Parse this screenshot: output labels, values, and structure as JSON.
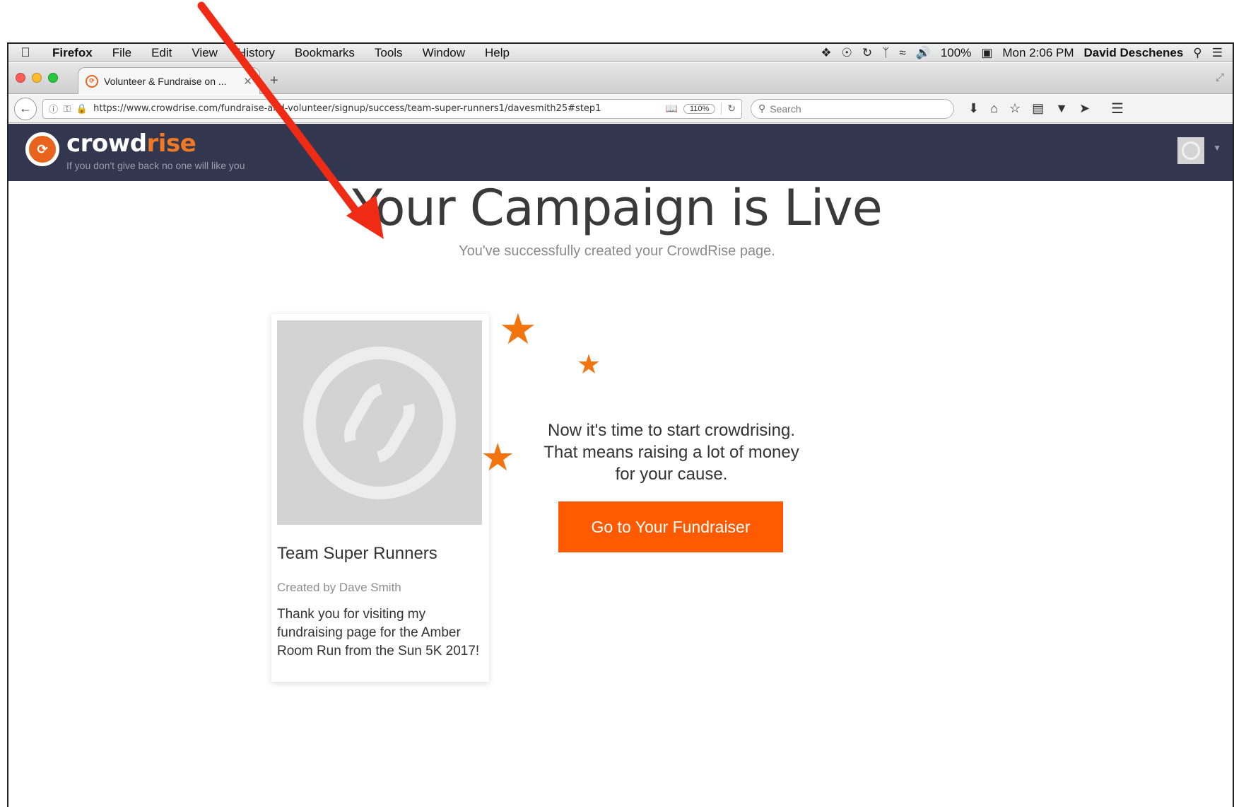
{
  "menubar": {
    "app": "Firefox",
    "items": [
      "File",
      "Edit",
      "View",
      "History",
      "Bookmarks",
      "Tools",
      "Window",
      "Help"
    ],
    "battery": "100%",
    "clock": "Mon 2:06 PM",
    "user": "David Deschenes"
  },
  "browser": {
    "tab_title": "Volunteer & Fundraise on ...",
    "url": "https://www.crowdrise.com/fundraise-and-volunteer/signup/success/team-super-runners1/davesmith25#step1",
    "zoom": "110%",
    "search_placeholder": "Search"
  },
  "site": {
    "brand_a": "crowd",
    "brand_b": "rise",
    "tagline": "If you don't give back no one will like you"
  },
  "hero": {
    "title": "Your Campaign is Live",
    "subtitle": "You've successfully created your CrowdRise page."
  },
  "card": {
    "title": "Team Super Runners",
    "creator": "Created by Dave Smith",
    "description": "Thank you for visiting my fundraising page for the Amber Room Run from the Sun 5K 2017!"
  },
  "cta": {
    "text": "Now it's time to start crowdrising. That means raising a lot of money for your cause.",
    "button_label": "Go to Your Fundraiser"
  },
  "colors": {
    "accent": "#ff5a00",
    "header_bg": "#33364f",
    "annotation_arrow": "#ef2b16"
  }
}
